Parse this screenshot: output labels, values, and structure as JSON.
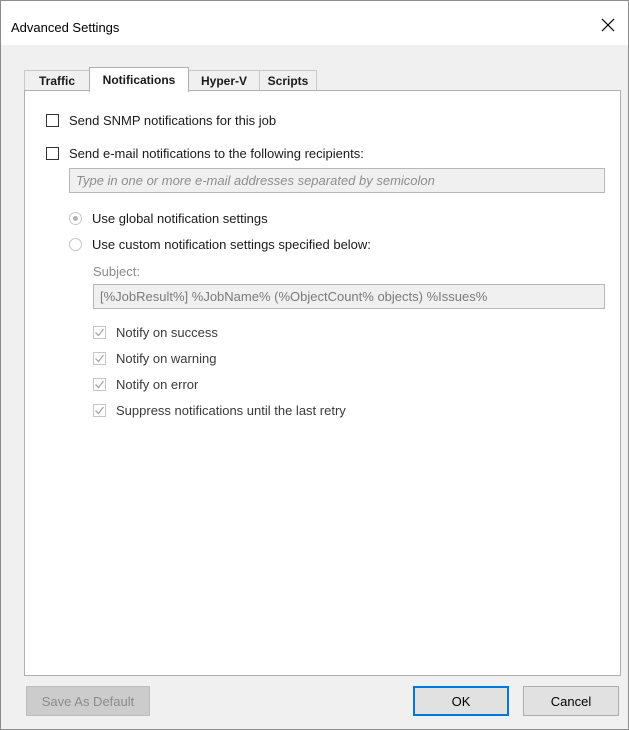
{
  "window": {
    "title": "Advanced Settings"
  },
  "tabs": [
    {
      "label": "Traffic",
      "active": false
    },
    {
      "label": "Notifications",
      "active": true
    },
    {
      "label": "Hyper-V",
      "active": false
    },
    {
      "label": "Scripts",
      "active": false
    }
  ],
  "notifications": {
    "snmp_label": "Send SNMP notifications for this job",
    "snmp_checked": false,
    "email_label": "Send e-mail notifications to the following recipients:",
    "email_checked": false,
    "email_placeholder": "Type in one or more e-mail addresses separated by semicolon",
    "radio_global_label": "Use global notification settings",
    "radio_global_selected": true,
    "radio_custom_label": "Use custom notification settings specified below:",
    "radio_custom_selected": false,
    "subject_label": "Subject:",
    "subject_value": "[%JobResult%] %JobName% (%ObjectCount% objects) %Issues%",
    "options": [
      {
        "label": "Notify on success",
        "checked": true
      },
      {
        "label": "Notify on warning",
        "checked": true
      },
      {
        "label": "Notify on error",
        "checked": true
      },
      {
        "label": "Suppress notifications until the last retry",
        "checked": true
      }
    ]
  },
  "footer": {
    "save_default_label": "Save As Default",
    "ok_label": "OK",
    "cancel_label": "Cancel"
  },
  "colors": {
    "accent": "#0078d7",
    "disabled_text": "#8c8c8c"
  }
}
